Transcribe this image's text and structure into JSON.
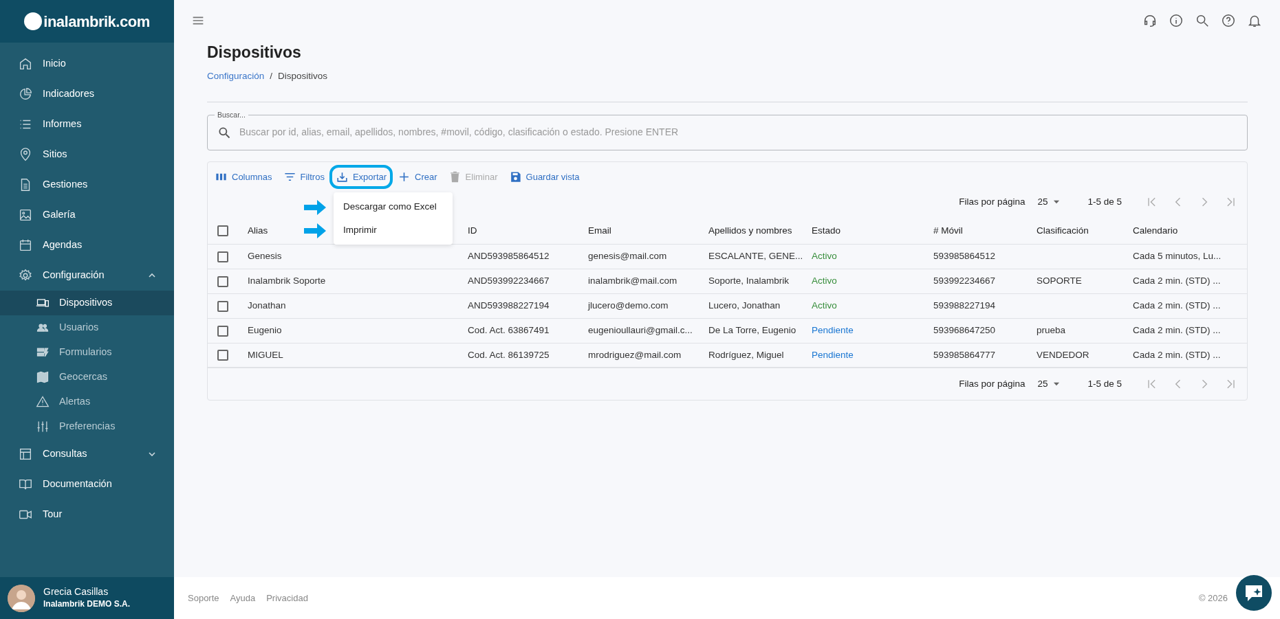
{
  "sidebar": {
    "logo": "inalambrik.com",
    "items": [
      {
        "label": "Inicio",
        "selected": false
      },
      {
        "label": "Indicadores",
        "selected": false
      },
      {
        "label": "Informes",
        "selected": false
      },
      {
        "label": "Sitios",
        "selected": false
      },
      {
        "label": "Gestiones",
        "selected": false
      },
      {
        "label": "Galería",
        "selected": false
      },
      {
        "label": "Agendas",
        "selected": false
      },
      {
        "label": "Configuración",
        "selected": false,
        "expanded": true,
        "children": [
          {
            "label": "Dispositivos",
            "selected": true
          },
          {
            "label": "Usuarios",
            "selected": false
          },
          {
            "label": "Formularios",
            "selected": false
          },
          {
            "label": "Geocercas",
            "selected": false
          },
          {
            "label": "Alertas",
            "selected": false
          },
          {
            "label": "Preferencias",
            "selected": false
          }
        ]
      },
      {
        "label": "Consultas",
        "selected": false,
        "expanded": false
      },
      {
        "label": "Documentación",
        "selected": false
      },
      {
        "label": "Tour",
        "selected": false
      }
    ],
    "user": {
      "name": "Grecia Casillas",
      "company": "Inalambrik DEMO S.A."
    }
  },
  "page": {
    "title": "Dispositivos",
    "breadcrumb": [
      {
        "label": "Configuración",
        "kind": "link"
      },
      {
        "label": "/",
        "kind": "separator"
      },
      {
        "label": "Dispositivos",
        "kind": "current"
      }
    ]
  },
  "search": {
    "label": "Buscar...",
    "placeholder": "Buscar por id, alias, email, apellidos, nombres, #movil, código, clasificación o estado. Presione ENTER"
  },
  "toolbar": [
    {
      "label": "Columnas",
      "disabled": false,
      "highlighted": false
    },
    {
      "label": "Filtros",
      "disabled": false,
      "highlighted": false
    },
    {
      "label": "Exportar",
      "disabled": false,
      "highlighted": true
    },
    {
      "label": "Crear",
      "disabled": false,
      "highlighted": false
    },
    {
      "label": "Eliminar",
      "disabled": true,
      "highlighted": false
    },
    {
      "label": "Guardar vista",
      "disabled": false,
      "highlighted": false
    }
  ],
  "export_menu": {
    "items": [
      {
        "label": "Descargar como Excel",
        "pointed": true
      },
      {
        "label": "Imprimir",
        "pointed": true
      }
    ]
  },
  "pagination_top": {
    "label": "Filas por página",
    "per_page": "25",
    "range": "1-5 de 5"
  },
  "pagination_bottom": {
    "label": "Filas por página",
    "per_page": "25",
    "range": "1-5 de 5"
  },
  "table": {
    "header_checked": false,
    "columns": [
      "Alias",
      "ID",
      "Email",
      "Apellidos y nombres",
      "Estado",
      "# Móvil",
      "Clasificación",
      "Calendario"
    ],
    "rows": [
      {
        "checked": false,
        "color": "#388e3c",
        "cells": [
          "Genesis",
          "AND593985864512",
          "genesis@mail.com",
          "ESCALANTE, GENE...",
          "Activo",
          "593985864512",
          "",
          "Cada 5 minutos, Lu..."
        ]
      },
      {
        "checked": false,
        "color": "#388e3c",
        "cells": [
          "Inalambrik Soporte",
          "AND593992234667",
          "inalambrik@mail.com",
          "Soporte, Inalambrik",
          "Activo",
          "593992234667",
          "SOPORTE",
          "Cada 2 min. (STD) ..."
        ]
      },
      {
        "checked": false,
        "color": "#388e3c",
        "cells": [
          "Jonathan",
          "AND593988227194",
          "jlucero@demo.com",
          "Lucero, Jonathan",
          "Activo",
          "593988227194",
          "",
          "Cada 2 min. (STD) ..."
        ]
      },
      {
        "checked": false,
        "color": "#1976d2",
        "cells": [
          "Eugenio",
          "Cod. Act. 63867491",
          "eugenioullauri@gmail.c...",
          "De La Torre, Eugenio",
          "Pendiente",
          "593968647250",
          "prueba",
          "Cada 2 min. (STD) ..."
        ]
      },
      {
        "checked": false,
        "color": "#1976d2",
        "cells": [
          "MIGUEL",
          "Cod. Act. 86139725",
          "mrodriguez@mail.com",
          "Rodríguez, Miguel",
          "Pendiente",
          "593985864777",
          "VENDEDOR",
          "Cada 2 min. (STD) ..."
        ]
      }
    ]
  },
  "footer": {
    "links": [
      "Soporte",
      "Ayuda",
      "Privacidad"
    ],
    "copyright": "© 2026"
  }
}
